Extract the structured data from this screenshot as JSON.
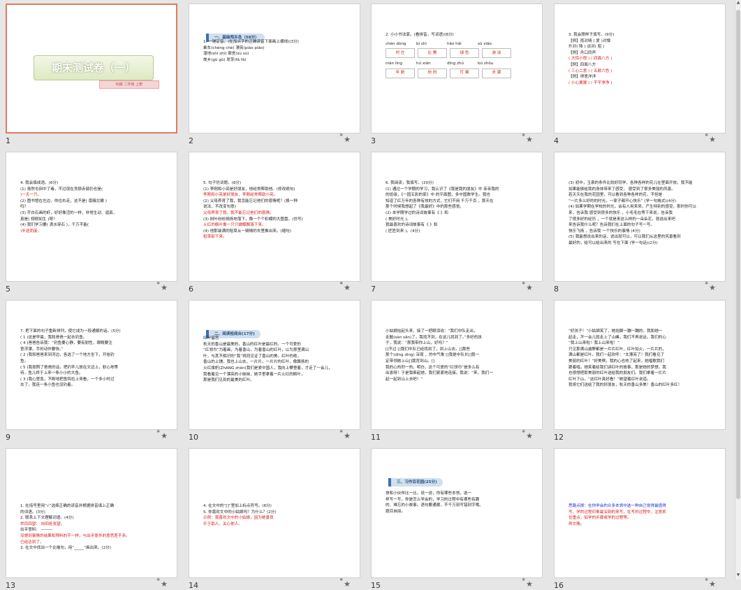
{
  "slides": [
    {
      "num": "1",
      "title": "期末测试卷（一）",
      "subtitle": "RJ版 二年级 上册",
      "star": false
    },
    {
      "num": "2",
      "section": "一、基础闯关岛（58分）",
      "lines": [
        {
          "t": "1. 一锤定音。(在加点字的正确读音下面画上横线)(3分)"
        },
        {
          "t": "    乘车(chéng chè)     漂亮(piào piāo)"
        },
        {
          "t": "    湿地(shī shì)     宿舍(sù sù)"
        },
        {
          "t": "    故乡(gù gǔ)     发芽(fā fà)"
        }
      ],
      "star": true
    },
    {
      "num": "3",
      "lines": [
        {
          "t": "2. 小小书法家。(看拼音，写词语)(8分)"
        }
      ],
      "pinyin": [
        "chén dòng",
        "bì shì",
        "hǎo hǎi",
        "sū xiǎo",
        "nián líng",
        "hú xiān",
        "dǐng zhú",
        "bù zhǒu"
      ],
      "answers": [
        "村 庄",
        "比 赛",
        "绿 色",
        "游 泳",
        "年 龄",
        "纷 纷",
        "叮 嘱",
        "步 骤"
      ],
      "star": true
    },
    {
      "num": "4",
      "lines": [
        {
          "t": "3. 我会照样子填写。(9分)"
        },
        {
          "t": "【例】雨对晴           (  爱  )对憎"
        },
        {
          "t": "升对(  降  )            谈对(  昭  )"
        },
        {
          "t": "【例】舟口同声"
        },
        {
          "t": "(  大惊小怪  )   (  四面八方  )",
          "red": true
        },
        {
          "t": "【例】四面八方"
        },
        {
          "t": "(  三心二意  )   (  五颜六色  )",
          "red": true
        },
        {
          "t": "【例】得意洋洋"
        },
        {
          "t": "(  小心翼翼  )   (  干干净净  )",
          "red": true
        }
      ],
      "star": true
    },
    {
      "num": "5",
      "lines": [
        {
          "t": "4. 我会填成语。(6分)"
        },
        {
          "t": "(1) 虽然屯田中了毒，不过现在贪狼赤狐仍也是("
        },
        {
          "t": "      )一天一只。",
          "red": true
        },
        {
          "t": "(2) 图书馆在左边，你往右走，这不是(  南辕北辙  )"
        },
        {
          "t": "      吗？"
        },
        {
          "t": "(3) 齐白石画的虾，好好像活的一样，非常生动、逼真，"
        },
        {
          "t": "      真是(  栩栩如生  )呀！"
        },
        {
          "t": "(4) 我们学习要(  滴水穿石  )，千万不能("
        },
        {
          "t": "      )半途而废。",
          "red": true
        }
      ],
      "star": true
    },
    {
      "num": "6",
      "lines": [
        {
          "t": "5. 句子仿词题。(8分)"
        },
        {
          "t": "(1) 李刚和小亮是好朋友，他经常帮助他。(修改病句)"
        },
        {
          "t": "      李刚和小亮是好朋友，李刚经常帮助小亮。",
          "red": true
        },
        {
          "t": "(2) 父母养育了我，我怎能忘记他们的恩情呢？(换一种"
        },
        {
          "t": "      说法，不改变句意)"
        },
        {
          "t": "      父母养育了我，我不能忘记他们的恩情。",
          "red": true
        },
        {
          "t": "(3) 树叶纷纷扬扬地落下，像一个个彩蝶的大图盘。(仿写)"
        },
        {
          "t": "      火红的枫叶像一只只蝴蝶飘落下来。",
          "red": true
        },
        {
          "t": "(4) 他那装满的稻草从一辆辆的车里推出来。(缩句)"
        },
        {
          "t": "      稻草卸下来。",
          "red": true
        }
      ],
      "star": true
    },
    {
      "num": "7",
      "lines": [
        {
          "t": "6. 我阅读，我填写。(20分)"
        },
        {
          "t": "(1) 通过一个学期的学习，我认识了《我是我的朋友》中 亲亲我的"
        },
        {
          "t": "      的班级，《一园五彩的家》中 的平面图，多中国数学生。我也"
        },
        {
          "t": "      知道了红万年的各种有效的方式，它们不用 千万千百 ，那天在"
        },
        {
          "t": "      那个时候我想起了《我最好》中的那些感觉。"
        },
        {
          "t": "(2) 本学期学过的诗词故事有《       》和"
        },
        {
          "t": "      (  美好时光  )。"
        },
        {
          "t": "      我最喜欢的诗词故事有《      》和"
        },
        {
          "t": "      (  匠匠到来  )。(4分)"
        }
      ],
      "star": true
    },
    {
      "num": "8",
      "lines": [
        {
          "t": "(3) 初中，玉泉的条件比较好同学，各种各样的花儿在里面开放。我不能"
        },
        {
          "t": "      如果能够给我的身体带来了感受，  感受到了很多美丽的风景。"
        },
        {
          "t": "      若天天在我的花园里，可以看到各种各样的花，不但是"
        },
        {
          "t": "      “一片多么好的的时光，一家子都开心快乐”  (学一句格式)(4分)"
        },
        {
          "t": "(4) 如果学期在学校的时光，会有人用来来，产生特别的感受。那时你可以"
        },
        {
          "t": "      来，告诉我  感受到很多的快乐  ，小毛毛在等下来说，告诉我"
        },
        {
          "t": "      了很多好的经历  ，一个就是来这么样的一朵朵花，就说出来吧"
        },
        {
          "t": "      来告诉我什么呢？告诉我们在上面的句子写一写。"
        },
        {
          "t": "      快乐飞扬  ，告诉我  一个快乐的事情  (4分)"
        },
        {
          "t": "(5) 我最想说出来的话，说出就可以，可以我们从这里的风景看到"
        },
        {
          "t": "      最好的，给可以给出来的  写在下面  (学一句话)(2分)"
        }
      ],
      "star": true
    },
    {
      "num": "9",
      "lines": [
        {
          "t": "7. 把下面的句子重新排列，使它成为一段通顺的话。(5分)"
        },
        {
          "t": "(  1  )这是早晨，我和爸爸一起去钓鱼。"
        },
        {
          "t": "(  4  )爸爸告诉我：“钓鱼要心静，要有耐性，眼睛要注"
        },
        {
          "t": "      意浮漂，手的动作要快。”"
        },
        {
          "t": "(  2  )我和爸爸来到河边，各选了一个地方坐下，开始钓"
        },
        {
          "t": "      鱼。"
        },
        {
          "t": "(  5  )我按照了爸爸的话，把钓竿儿放在文边上，耐心地等"
        },
        {
          "t": "      待，鱼儿终于上来一条小小的大鱼。"
        },
        {
          "t": "(  3  )我心里急，不断地把鱼钩拉上来看，一个多小时过"
        },
        {
          "t": "      去了，我连一条小鱼也没钓着。"
        }
      ],
      "star": true
    },
    {
      "num": "10",
      "section": "二、阅读检阅台(17分)",
      "lines": [
        {
          "t": "                       红叶留宫"
        },
        {
          "t": "    秋天的香山是最美的，香山的红叶是最红的。一个可爱的"
        },
        {
          "t": "“红领巾”为着画，为着香山，为着香山的红叶，以为那里满山"
        },
        {
          "t": "叶，与其不相识的“我”将同见证了香山的美。红叶的绝，"
        },
        {
          "t": "    香山的上铺，我也上山去，一片片，一片片的红叶，像飘扬的"
        },
        {
          "t": "火红旗帜(ZhANG zhēn)我们是爱中国人，我向上攀登着，才走了一会儿，"
        },
        {
          "t": "我看着见一个漂亮的小妹妹，她手里拿着一片火红的枫叶，"
        },
        {
          "t": "那是我们见到的最美的红叶。"
        }
      ],
      "star": true
    },
    {
      "num": "11",
      "lines": [
        {
          "t": "    小姑娘抬起头来，接了一把眼泪说：“我们中队走出，"
        },
        {
          "t": "走散(sàn  sǎn)了。我找不到，在这儿找到了。”多好的孩"
        },
        {
          "t": "子，我说：“那我带你上山，好吗？”"
        },
        {
          "t": "    []不过  []我们中队已经找到了，到上山去。[]那些"
        },
        {
          "t": "那个(dīng  dìng)  深夜  ，的中气象  []我是中队长[]我一"
        },
        {
          "t": "定带领她上山[]我背到山。[]"
        },
        {
          "t": "    我的心热烈一热，明白，这个可爱的“红领巾”是多么有"
        },
        {
          "t": "出息呀！于是我牵起她，我们紧紧地连接。我说：“来，我们一"
        },
        {
          "t": "起一起到山上去吧！”"
        }
      ],
      "star": true
    },
    {
      "num": "12",
      "lines": [
        {
          "t": "    “好孩子！”小姑娘笑了，她抬脚一蹦一蹦的。我和她一"
        },
        {
          "t": "起走，不一会儿就走上了山峰，我们不再说话，我们的心"
        },
        {
          "t": "    “我上山来啦！我上山来啦！”"
        },
        {
          "t": "    只见那满山遍野都是一片片红叶，红叶如火，一片片的，"
        },
        {
          "t": "满山都是红叶。我们一起欢呼：“太漂亮了！我们看见了"
        },
        {
          "t": "美丽的红叶！”好美啊，我的心也热了起来，她唱歌我们"
        },
        {
          "t": "跟着唱，她笑着给我们讲红叶的故事，那是她的梦想，我"
        },
        {
          "t": "也很想把那美丽的红叶送给我的朋友们。我们拿着一片片"
        },
        {
          "t": "红叶下山，“这红叶真好看！”她望着红叶说道。"
        },
        {
          "t": "    我将它们送给了我的好朋友，秋天的香山多美！香山的红叶多红！"
        }
      ],
      "star": false
    },
    {
      "num": "13",
      "lines": [
        {
          "t": "1. 在括号里用“√”选择正确的读音并根据拼音填上正确"
        },
        {
          "t": "    的词语。(3分)"
        },
        {
          "t": "2. 联系上下文理解词语。(4分)"
        },
        {
          "t": "    举目四望：  向四处张望。",
          "red": true
        },
        {
          "t": "    出乎意料：  ———"
        },
        {
          "t": "    没想到事情的结果和预料的不一样，与出乎意外的意思差不多。",
          "red": true
        },
        {
          "t": "    已经达到了。",
          "red": true
        },
        {
          "t": "3. 在文中找出一个比喻句，用“_____”画出来。(2分)"
        }
      ],
      "star": true
    },
    {
      "num": "14",
      "lines": [
        {
          "t": "4. 在文中的“[]”里加上标点符号。(6分)"
        },
        {
          "t": "5. 你喜欢文中的小姑娘吗？为什么？(2分)"
        },
        {
          "t": "    示例：我喜欢文中的小姑娘，因为她善良",
          "red": true
        },
        {
          "t": "    乐于助人，关心他人。",
          "red": true
        }
      ],
      "star": true
    },
    {
      "num": "15",
      "section": "三、习作百花园(25分)",
      "lines": [
        {
          "t": "    快和小伙伴比一比，说一说，你有哪些本领，选一"
        },
        {
          "t": "样写一写，你是怎么学会的，学习的过程中有哪些有趣"
        },
        {
          "t": "的、难忘的小故事。语句要通顺，不千万别写错别字哦。"
        },
        {
          "t": "题目自拟。"
        }
      ],
      "star": true
    },
    {
      "num": "16",
      "lines": [
        {
          "t": "思路点拨：在你学会的众多本领中选一种自己觉得最值得",
          "blue": true
        },
        {
          "t": "写、学的过程印象最深刻的来写，在写的过程中，注意抓",
          "red": true
        },
        {
          "t": "住重点，如学的步骤或学的过程等。",
          "red": true
        },
        {
          "t": "例文略。",
          "red": true
        }
      ],
      "star": true
    }
  ],
  "icons": {
    "star": "star-icon",
    "scroll_up": "scroll-up-icon",
    "scroll_down": "scroll-down-icon"
  },
  "colors": {
    "selected_border": "#e07b5d",
    "answer_red": "#d81919",
    "hint_blue": "#1a2ad6"
  }
}
